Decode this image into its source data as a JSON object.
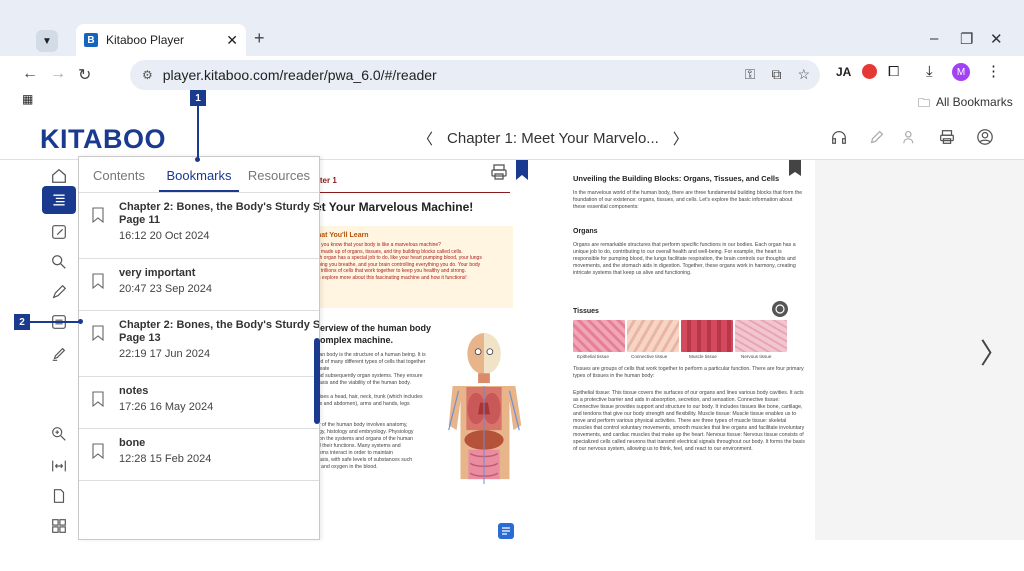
{
  "browser": {
    "tab_title": "Kitaboo Player",
    "tab_favicon": "B",
    "url": "player.kitaboo.com/reader/pwa_6.0/#/reader",
    "bookmarks_bar_label": "All Bookmarks",
    "profile_initial": "M"
  },
  "app": {
    "logo": "KITABOO",
    "chapter_title": "Chapter 1: Meet Your Marvelo..."
  },
  "panel": {
    "tabs": [
      "Contents",
      "Bookmarks",
      "Resources"
    ],
    "active_tab": "Bookmarks",
    "items": [
      {
        "title": "Chapter 2: Bones, the Body's Sturdy Scaffold|",
        "subtitle": "Page 11",
        "date": "16:12 20 Oct 2024"
      },
      {
        "title": "very important",
        "subtitle": "",
        "date": "20:47 23 Sep 2024"
      },
      {
        "title": "Chapter 2: Bones, the Body's Sturdy Scaffold|",
        "subtitle": "Page 13",
        "date": "22:19 17 Jun 2024"
      },
      {
        "title": "notes",
        "subtitle": "",
        "date": "17:26 16 May 2024"
      },
      {
        "title": "bone",
        "subtitle": "",
        "date": "12:28 15 Feb 2024"
      }
    ]
  },
  "badges": {
    "one": "1",
    "two": "2"
  },
  "page_left": {
    "chapter_label": "pter 1",
    "heading": "et Your Marvelous Machine!",
    "learn_heading": "hat You'll Learn",
    "learn_lines": [
      "d you know that your body is like a marvelous machine?",
      "s made up of organs, tissues, and tiny building blocks called cells.",
      "ch organ has a special job to do, like your heart pumping blood, your lungs",
      "lping you breathe, and your brain controlling everything you do. Your body",
      "s trillions of cells that work together to keep you healthy and strong.",
      "'s explore more about this fascinating machine and how it functions!"
    ],
    "overview_heading_1": "verview of the human body",
    "overview_heading_2": "complex machine.",
    "overview_lines": [
      "man body is the structure of a human being. It is",
      "sed of many different types of cells that together create",
      "and subsequently organ systems. They ensure",
      "stasis and the viability of the human body.",
      "",
      "prises a head, hair, neck, trunk (which includes",
      "rax and abdomen), arms and hands, legs",
      "s.",
      "",
      "dy of the human body involves anatomy,",
      "logy, histology and embryology. Physiology",
      "s on the systems and organs of the human",
      "nd their functions. Many systems and",
      "nisms interact in order to maintain",
      "stasis, with safe levels of substances such",
      "ar and oxygen in the blood."
    ]
  },
  "page_right": {
    "heading": "Unveiling the Building Blocks: Organs, Tissues, and Cells",
    "intro": "In the marvelous world of the human body, there are three fundamental building blocks that form the foundation of our existence: organs, tissues, and cells. Let's explore the basic information about these essential components:",
    "organs_heading": "Organs",
    "organs_text": "Organs are remarkable structures that perform specific functions in our bodies. Each organ has a unique job to do, contributing to our overall health and well-being. For example, the heart is responsible for pumping blood, the lungs facilitate respiration, the brain controls our thoughts and movements, and the stomach aids in digestion. Together, these organs work in harmony, creating intricate systems that keep us alive and functioning.",
    "tissues_heading": "Tissues",
    "tissue_captions": [
      "Epithelial tissue",
      "Connective tissue",
      "Muscle tissue",
      "Nervous tissue"
    ],
    "tissues_text": "Tissues are groups of cells that work together to perform a particular function. There are four primary types of tissues in the human body:",
    "tissue_defs": "Epithelial tissue: This tissue covers the surfaces of our organs and lines various body cavities. It acts as a protective barrier and aids in absorption, secretion, and sensation. Connective tissue: Connective tissue provides support and structure to our body. It includes tissues like bone, cartilage, and tendons that give our body strength and flexibility. Muscle tissue: Muscle tissue enables us to move and perform various physical activities. There are three types of muscle tissue: skeletal muscles that control voluntary movements, smooth muscles that line organs and facilitate involuntary movements, and cardiac muscles that make up the heart. Nervous tissue: Nervous tissue consists of specialized cells called neurons that transmit electrical signals throughout our body. It forms the basis of our nervous system, allowing us to think, feel, and react to our environment."
  },
  "colors": {
    "brand": "#1a3a8f",
    "panel_border": "#c9c9c9"
  }
}
